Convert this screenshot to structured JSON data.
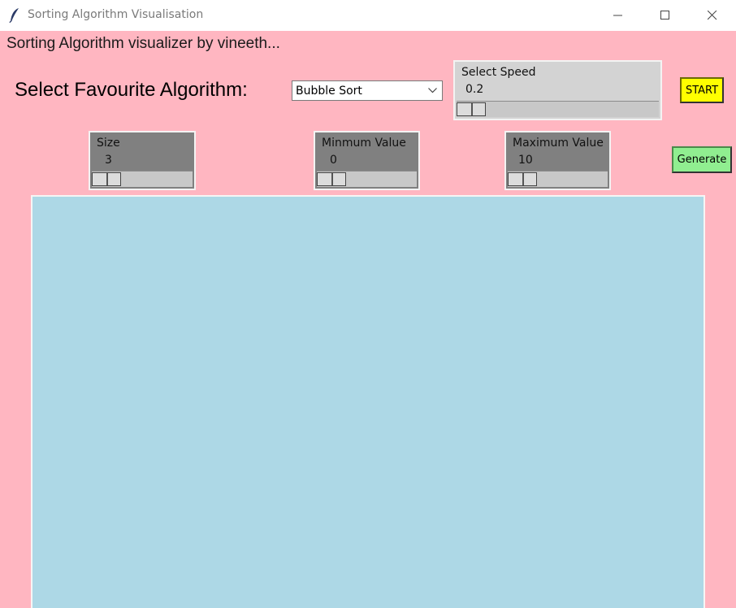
{
  "window": {
    "title": "Sorting Algorithm Visualisation"
  },
  "heading": "Sorting Algorithm visualizer by vineeth...",
  "algorithm": {
    "label": "Select Favourite Algorithm:",
    "selected": "Bubble Sort"
  },
  "speed": {
    "label": "Select Speed",
    "value": "0.2",
    "level": 0.0
  },
  "start_button": "START",
  "size": {
    "label": "Size",
    "value": "3",
    "level": 0.0
  },
  "min_value": {
    "label": "Minmum Value",
    "value": "0",
    "level": 0.0
  },
  "max_value": {
    "label": "Maximum Value",
    "value": "10",
    "level": 0.0
  },
  "generate_button": "Generate",
  "colors": {
    "background": "#ffb6c1",
    "canvas": "#add8e6",
    "start": "#ffff00",
    "generate": "#90ee90"
  },
  "icons": [
    "feather-icon",
    "minimize-icon",
    "maximize-icon",
    "close-icon",
    "chevron-down-icon"
  ]
}
